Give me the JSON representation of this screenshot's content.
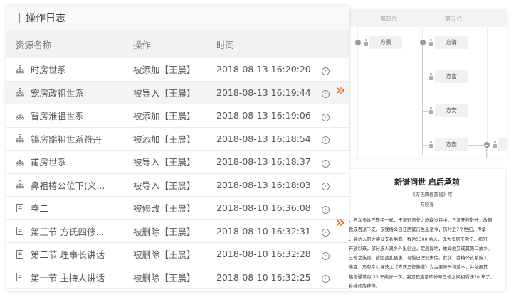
{
  "panel": {
    "title": "操作日志",
    "accent": "#f06a22"
  },
  "columns": {
    "name": "资源名称",
    "action": "操作",
    "time": "时间"
  },
  "rows": [
    {
      "icon": "tree-icon",
      "name": "时房世系",
      "action": "被添加【王晨】",
      "time": "2018-08-13 16:20:20"
    },
    {
      "icon": "tree-icon",
      "name": "宠房政祖世系",
      "action": "被导入【王晨】",
      "time": "2018-08-13 16:19:44"
    },
    {
      "icon": "tree-icon",
      "name": "智房淮祖世系",
      "action": "被添加【王晨】",
      "time": "2018-08-13 16:19:06"
    },
    {
      "icon": "tree-icon",
      "name": "锡房豁祖世系符丹",
      "action": "被添加【王晨】",
      "time": "2018-08-13 16:18:54"
    },
    {
      "icon": "tree-icon",
      "name": "甫房世系",
      "action": "被导入【王晨】",
      "time": "2018-08-13 16:18:37"
    },
    {
      "icon": "tree-icon",
      "name": "鼻祖椿公位下(义...",
      "action": "被导入【王晨】",
      "time": "2018-08-13 16:18:03"
    },
    {
      "icon": "document-icon",
      "name": "卷二",
      "action": "被修改【王晨】",
      "time": "2018-08-10 16:36:08"
    },
    {
      "icon": "document-icon",
      "name": "第三节 方氏四修...",
      "action": "被删除【王晨】",
      "time": "2018-08-10 16:32:31"
    },
    {
      "icon": "document-icon",
      "name": "第二节 理事长讲话",
      "action": "被删除【王晨】",
      "time": "2018-08-10 16:32:28"
    },
    {
      "icon": "document-icon",
      "name": "第一节 主持人讲话",
      "action": "被删除【王晨】",
      "time": "2018-08-10 16:32:25"
    }
  ],
  "arrow": "»",
  "go": "›",
  "tree": {
    "generations": [
      "第四代",
      "第五代"
    ],
    "nodes": [
      "方贵",
      "方清",
      "方富",
      "方安",
      "方泰"
    ]
  },
  "doc": {
    "title": "新谱问世  启后承前",
    "subtitle": "——《方氏四修族谱》序",
    "author": "方映春",
    "lines": [
      "，与众多姓氏先祖一样，于源远流长之峥嵘岁月中，日渐开枝散叶，故期",
      "款成百派千支。仅我椿公自江西繁衍生息至今，历时近7个世纪，传承",
      "，寻访入册之椿公支系后裔，数达5300 余人，现大多居于常宁、祁阳、",
      "开放以来，部分族人离乡外出创业，定居异地，故异地又成其第二故乡。",
      "三修之族谱，皆因战乱祸患，可惜已湮没失传。此次，我椿公支系族人",
      "事宜，乃有幸以寻获之《方氏三修族谱》为主要源头和蓝本，并依据其",
      "族谱通常每 30 年续修一次，我方氏族谱四修与三修之间相隔快70 年了，",
      "补续修族使然。"
    ]
  }
}
